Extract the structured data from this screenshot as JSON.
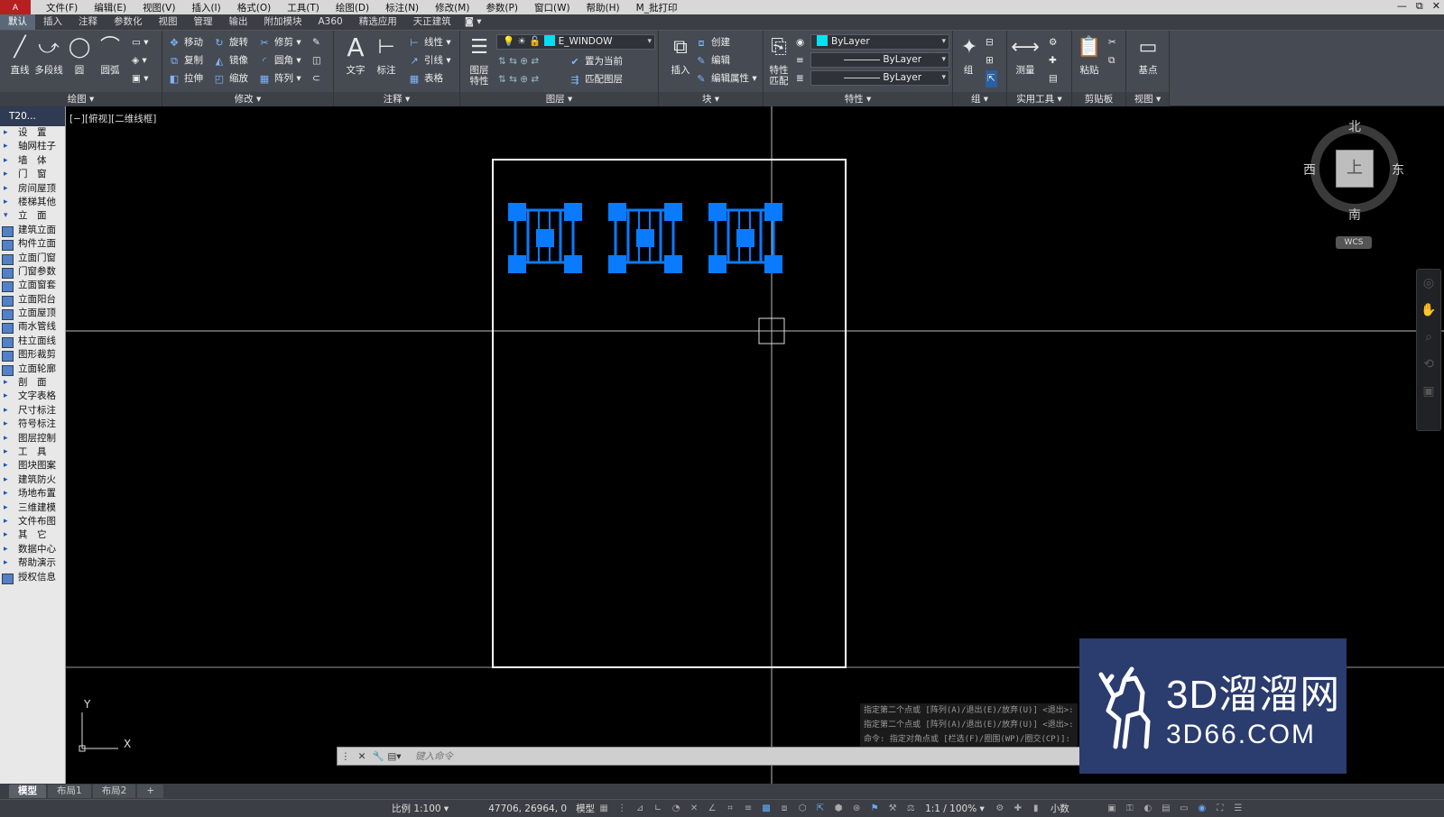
{
  "menu": {
    "logo": "A",
    "items": [
      "文件(F)",
      "编辑(E)",
      "视图(V)",
      "插入(I)",
      "格式(O)",
      "工具(T)",
      "绘图(D)",
      "标注(N)",
      "修改(M)",
      "参数(P)",
      "窗口(W)",
      "帮助(H)",
      "M_批打印"
    ],
    "window_controls": [
      "—",
      "⧉",
      "✕"
    ]
  },
  "tabs": [
    "默认",
    "插入",
    "注释",
    "参数化",
    "视图",
    "管理",
    "输出",
    "附加模块",
    "A360",
    "精选应用",
    "天正建筑"
  ],
  "ribbon": {
    "draw": {
      "title": "绘图 ▾",
      "line": "直线",
      "polyline": "多段线",
      "circle": "圆",
      "arc": "圆弧"
    },
    "modify": {
      "title": "修改 ▾",
      "move": "移动",
      "rotate": "旋转",
      "trim": "修剪",
      "copy": "复制",
      "mirror": "镜像",
      "fillet": "圆角",
      "stretch": "拉伸",
      "scale": "缩放",
      "array": "阵列"
    },
    "annotate": {
      "title": "注释 ▾",
      "text": "文字",
      "dim": "标注",
      "linear": "线性",
      "leader": "引线",
      "table": "表格"
    },
    "layer": {
      "title": "图层 ▾",
      "props": "图层\n特性",
      "current_layer": "E_WINDOW",
      "set_current": "置为当前",
      "match": "匹配图层"
    },
    "block": {
      "title": "块 ▾",
      "insert": "插入",
      "create": "创建",
      "edit": "编辑",
      "edit_attr": "编辑属性"
    },
    "properties": {
      "title": "特性 ▾",
      "match": "特性\n匹配",
      "color": "ByLayer",
      "linetype": "ByLayer",
      "lineweight": "ByLayer"
    },
    "group": {
      "title": "组 ▾",
      "group": "组"
    },
    "utilities": {
      "title": "实用工具 ▾",
      "measure": "测量"
    },
    "clipboard": {
      "title": "剪贴板",
      "paste": "粘贴"
    },
    "view": {
      "title": "视图 ▾",
      "base": "基点"
    }
  },
  "left_panel": {
    "header": "T20...",
    "items": [
      {
        "label": "设　置",
        "type": "grp"
      },
      {
        "label": "轴网柱子",
        "type": "grp"
      },
      {
        "label": "墙　体",
        "type": "grp"
      },
      {
        "label": "门　窗",
        "type": "grp"
      },
      {
        "label": "房间屋顶",
        "type": "grp"
      },
      {
        "label": "楼梯其他",
        "type": "grp"
      },
      {
        "label": "立　面",
        "type": "grp open"
      },
      {
        "label": "建筑立面",
        "type": "sub"
      },
      {
        "label": "构件立面",
        "type": "sub"
      },
      {
        "label": "立面门窗",
        "type": "sub"
      },
      {
        "label": "门窗参数",
        "type": "sub"
      },
      {
        "label": "立面窗套",
        "type": "sub"
      },
      {
        "label": "立面阳台",
        "type": "sub"
      },
      {
        "label": "立面屋顶",
        "type": "sub"
      },
      {
        "label": "雨水管线",
        "type": "sub"
      },
      {
        "label": "柱立面线",
        "type": "sub"
      },
      {
        "label": "图形裁剪",
        "type": "sub"
      },
      {
        "label": "立面轮廓",
        "type": "sub"
      },
      {
        "label": "剖　面",
        "type": "grp"
      },
      {
        "label": "文字表格",
        "type": "grp"
      },
      {
        "label": "尺寸标注",
        "type": "grp"
      },
      {
        "label": "符号标注",
        "type": "grp"
      },
      {
        "label": "图层控制",
        "type": "grp"
      },
      {
        "label": "工　具",
        "type": "grp"
      },
      {
        "label": "图块图案",
        "type": "grp"
      },
      {
        "label": "建筑防火",
        "type": "grp"
      },
      {
        "label": "场地布置",
        "type": "grp"
      },
      {
        "label": "三维建模",
        "type": "grp"
      },
      {
        "label": "文件布图",
        "type": "grp"
      },
      {
        "label": "其　它",
        "type": "grp"
      },
      {
        "label": "数据中心",
        "type": "grp"
      },
      {
        "label": "帮助演示",
        "type": "grp"
      },
      {
        "label": "授权信息",
        "type": "sub"
      }
    ]
  },
  "viewport": {
    "label": "[−][俯视][二维线框]"
  },
  "viewcube": {
    "north": "北",
    "south": "南",
    "west": "西",
    "east": "东",
    "top": "上",
    "wcs": "WCS"
  },
  "command": {
    "history": [
      "指定第二个点或 [阵列(A)/退出(E)/放弃(U)] <退出>:",
      "指定第二个点或 [阵列(A)/退出(E)/放弃(U)] <退出>:",
      "命令: 指定对角点或 [栏选(F)/圈围(WP)/圈交(CP)]:"
    ],
    "placeholder": "键入命令"
  },
  "ucs": {
    "x": "X",
    "y": "Y"
  },
  "watermark": {
    "brand": "3D溜溜网",
    "url": "3D66.COM"
  },
  "layout_tabs": [
    "模型",
    "布局1",
    "布局2",
    "+"
  ],
  "status": {
    "scale": "比例 1:100 ▾",
    "coords": "47706, 26964, 0",
    "space": "模型",
    "annoscale": "1:1 / 100% ▾",
    "units": "小数"
  },
  "colors": {
    "accent": "#0a7bff",
    "bg": "#000000",
    "ribbon": "#464a52"
  }
}
